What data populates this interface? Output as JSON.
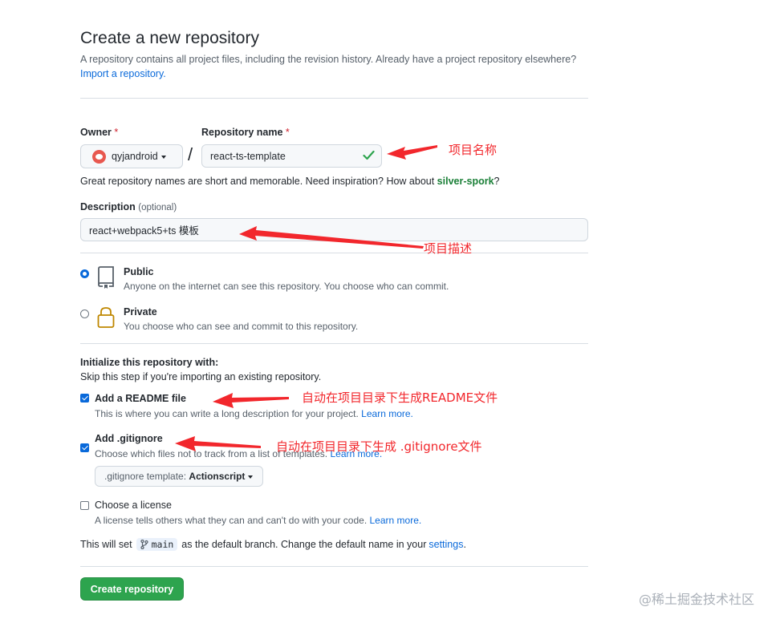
{
  "header": {
    "title": "Create a new repository",
    "description": "A repository contains all project files, including the revision history. Already have a project repository elsewhere?",
    "import_link": "Import a repository."
  },
  "owner": {
    "label": "Owner",
    "required_mark": "*",
    "value": "qyjandroid"
  },
  "separator": "/",
  "repo_name": {
    "label": "Repository name",
    "required_mark": "*",
    "value": "react-ts-template"
  },
  "name_hint": {
    "prefix": "Great repository names are short and memorable. Need inspiration? How about ",
    "suggestion": "silver-spork",
    "suffix": "?"
  },
  "description": {
    "label": "Description",
    "optional": "(optional)",
    "value": "react+webpack5+ts 模板"
  },
  "visibility": {
    "public": {
      "title": "Public",
      "desc": "Anyone on the internet can see this repository. You choose who can commit.",
      "selected": true
    },
    "private": {
      "title": "Private",
      "desc": "You choose who can see and commit to this repository.",
      "selected": false
    }
  },
  "init": {
    "title": "Initialize this repository with:",
    "subtitle": "Skip this step if you're importing an existing repository.",
    "readme": {
      "label": "Add a README file",
      "desc": "This is where you can write a long description for your project.",
      "link": "Learn more.",
      "checked": true
    },
    "gitignore": {
      "label": "Add .gitignore",
      "desc": "Choose which files not to track from a list of templates.",
      "link": "Learn more.",
      "checked": true,
      "template_prefix": ".gitignore template:",
      "template_value": "Actionscript"
    },
    "license": {
      "label": "Choose a license",
      "desc": "A license tells others what they can and can't do with your code.",
      "link": "Learn more.",
      "checked": false
    }
  },
  "branch": {
    "prefix": "This will set",
    "name": "main",
    "middle": "as the default branch. Change the default name in your",
    "link": "settings",
    "suffix": "."
  },
  "submit": {
    "label": "Create repository"
  },
  "annotations": {
    "repo_name": "项目名称",
    "description": "项目描述",
    "readme": "自动在项目目录下生成README文件",
    "gitignore": "自动在项目目录下生成 .gitignore文件"
  },
  "watermark": "@稀土掘金技术社区",
  "colors": {
    "link": "#0969da",
    "primary": "#2da44e",
    "annotation": "#f2272c",
    "success": "#2da44e"
  }
}
